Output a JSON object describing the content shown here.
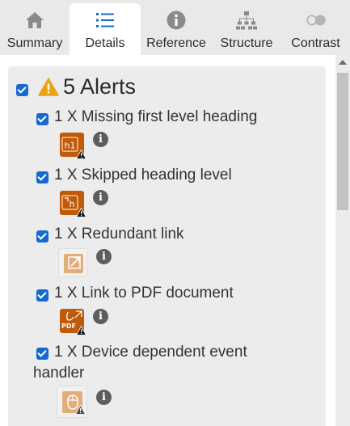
{
  "tabs": [
    {
      "label": "Summary",
      "icon": "home-icon",
      "active": false
    },
    {
      "label": "Details",
      "icon": "list-icon",
      "active": true
    },
    {
      "label": "Reference",
      "icon": "info-icon",
      "active": false
    },
    {
      "label": "Structure",
      "icon": "sitemap-icon",
      "active": false
    },
    {
      "label": "Contrast",
      "icon": "contrast-icon",
      "active": false
    }
  ],
  "alerts": {
    "title": "5 Alerts",
    "checked": true,
    "items": [
      {
        "label": "1 X Missing first level heading",
        "badge": "h1",
        "checked": true
      },
      {
        "label": "1 X Skipped heading level",
        "badge": "h",
        "checked": true
      },
      {
        "label": "1 X Redundant link",
        "badge": "link",
        "checked": true
      },
      {
        "label": "1 X Link to PDF document",
        "badge": "PDF",
        "checked": true
      },
      {
        "label_line1": "1 X Device dependent event",
        "label_line2": "handler",
        "badge": "mouse",
        "checked": true
      }
    ]
  },
  "colors": {
    "tab_bar": "#e9e9e9",
    "panel": "#ececec",
    "checkbox": "#1669d3",
    "alert_orange": "#c05a09",
    "warning_yellow": "#e8a317"
  }
}
